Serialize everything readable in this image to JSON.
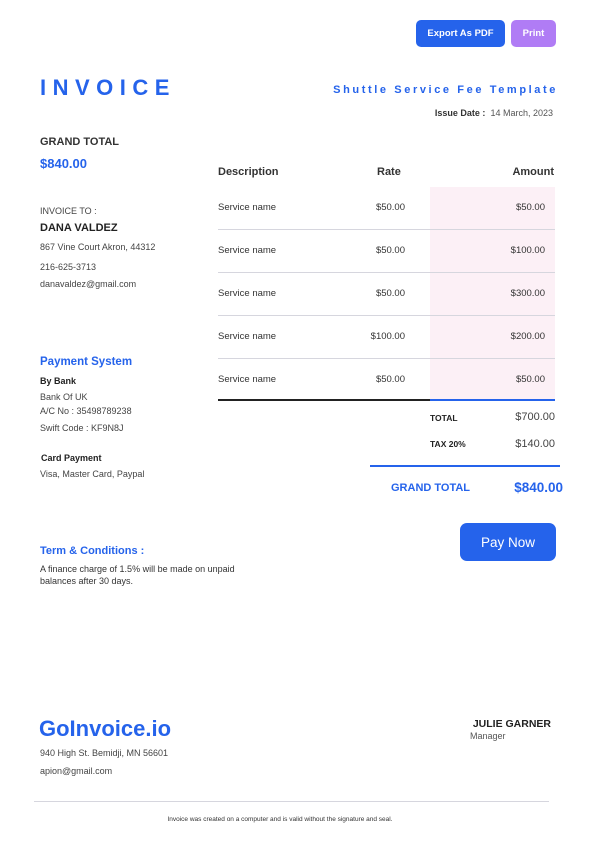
{
  "toolbar": {
    "export_label": "Export As PDF",
    "print_label": "Print"
  },
  "header": {
    "title": "INVOICE",
    "template_name": "Shuttle Service Fee Template",
    "issue_date_label": "Issue Date :",
    "issue_date": "14 March, 2023"
  },
  "summary": {
    "grand_total_label": "GRAND TOTAL",
    "grand_total_value": "$840.00"
  },
  "client": {
    "label": "INVOICE TO :",
    "name": "DANA VALDEZ",
    "address": "867 Vine Court  Akron, 44312",
    "phone": "216-625-3713",
    "email": "danavaldez@gmail.com"
  },
  "payment": {
    "title": "Payment System",
    "bank_heading": "By Bank",
    "bank_name": "Bank Of UK",
    "account": "A/C No : 35498789238",
    "swift": "Swift Code : KF9N8J",
    "card_heading": "Card Payment",
    "cards": "Visa, Master Card, Paypal"
  },
  "table": {
    "headers": {
      "description": "Description",
      "rate": "Rate",
      "amount": "Amount"
    },
    "rows": [
      {
        "description": "Service name",
        "rate": "$50.00",
        "amount": "$50.00"
      },
      {
        "description": "Service name",
        "rate": "$50.00",
        "amount": "$100.00"
      },
      {
        "description": "Service name",
        "rate": "$50.00",
        "amount": "$300.00"
      },
      {
        "description": "Service name",
        "rate": "$100.00",
        "amount": "$200.00"
      },
      {
        "description": "Service name",
        "rate": "$50.00",
        "amount": "$50.00"
      }
    ]
  },
  "totals": {
    "total_label": "TOTAL",
    "total_value": "$700.00",
    "tax_label": "TAX 20%",
    "tax_value": "$140.00",
    "grand_label": "GRAND TOTAL",
    "grand_value": "$840.00"
  },
  "pay_button_label": "Pay Now",
  "terms": {
    "title": "Term & Conditions :",
    "text": "A finance charge of 1.5% will be made on unpaid balances after 30 days."
  },
  "company": {
    "name": "GoInvoice.io",
    "address": "940 High St. Bemidji, MN 56601",
    "email": "apion@gmail.com"
  },
  "signer": {
    "name": "JULIE GARNER",
    "role": "Manager"
  },
  "footer_note": "Invoice was created on a computer and is valid without the signature and seal.",
  "colors": {
    "accent": "#2563eb",
    "print_button": "#b07cf5",
    "amount_column_bg": "#fcf0f6"
  }
}
